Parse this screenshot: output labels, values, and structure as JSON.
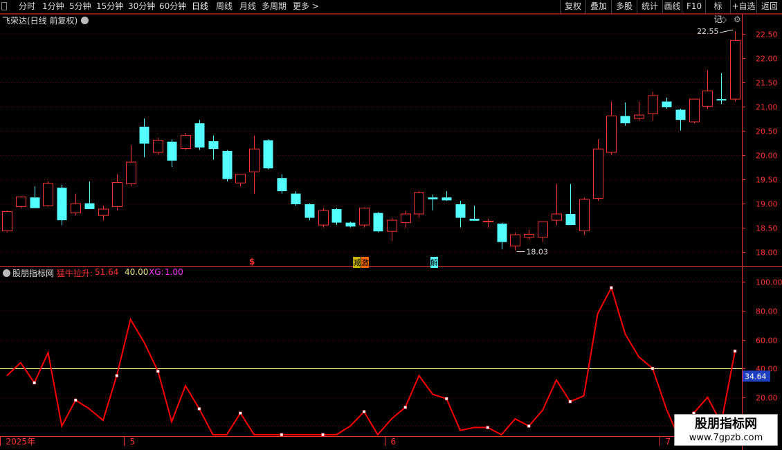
{
  "toolbar": {
    "left_items": [
      "分时",
      "1分钟",
      "5分钟",
      "15分钟",
      "30分钟",
      "60分钟",
      "日线",
      "周线",
      "月线",
      "多周期",
      "更多"
    ],
    "active": "日线",
    "right_items": [
      "复权",
      "叠加",
      "多股",
      "统计",
      "画线",
      "F10",
      "标记",
      "+自选",
      "返回"
    ]
  },
  "main_title": "飞荣达(日线 前复权)",
  "indicator_header": {
    "name": "股朋指标网",
    "s1_label": "猛牛拉升:",
    "s1_value": "51.64",
    "s2_value": "40.00",
    "xg_label": "XG:",
    "xg_value": "1.00"
  },
  "signals": [
    "$",
    "减",
    "激",
    "解"
  ],
  "watermark": {
    "name": "股朋指标网",
    "url": "www.7gpzb.com"
  },
  "colors": {
    "up": "#ff3232",
    "down": "#54ffff",
    "line": "#ff0000",
    "ref": "#f0e68c",
    "grid": "#6b0000",
    "axis": "#ff3232"
  },
  "chart_data": [
    {
      "type": "candlestick",
      "title": "飞荣达(日线 前复权)",
      "y_ticks": [
        18.0,
        18.5,
        19.0,
        19.5,
        20.0,
        20.5,
        21.0,
        21.5,
        22.0,
        22.5
      ],
      "ylim": [
        17.88,
        22.68
      ],
      "annotations": {
        "max": "22.55",
        "min": "18.03"
      },
      "ohlc": [
        [
          18.43,
          18.85,
          18.4,
          18.83
        ],
        [
          18.93,
          19.15,
          18.9,
          19.13
        ],
        [
          19.12,
          19.35,
          18.95,
          18.9
        ],
        [
          18.95,
          19.45,
          18.93,
          19.41
        ],
        [
          19.32,
          19.38,
          18.55,
          18.65
        ],
        [
          18.8,
          19.2,
          18.75,
          18.99
        ],
        [
          19.0,
          19.45,
          18.9,
          18.88
        ],
        [
          18.75,
          18.95,
          18.65,
          18.88
        ],
        [
          18.93,
          19.6,
          18.85,
          19.43
        ],
        [
          19.4,
          20.2,
          19.35,
          19.85
        ],
        [
          20.58,
          20.75,
          19.95,
          20.23
        ],
        [
          20.05,
          20.35,
          20.0,
          20.3
        ],
        [
          20.27,
          20.32,
          19.75,
          19.88
        ],
        [
          20.13,
          20.45,
          20.1,
          20.4
        ],
        [
          20.65,
          20.72,
          20.1,
          20.15
        ],
        [
          20.28,
          20.4,
          19.9,
          20.12
        ],
        [
          20.08,
          20.1,
          19.45,
          19.5
        ],
        [
          19.42,
          19.55,
          19.35,
          19.6
        ],
        [
          19.65,
          20.4,
          19.2,
          20.12
        ],
        [
          20.3,
          20.32,
          19.7,
          19.72
        ],
        [
          19.52,
          19.6,
          19.2,
          19.25
        ],
        [
          19.2,
          19.25,
          18.95,
          18.98
        ],
        [
          18.98,
          19.0,
          18.65,
          18.7
        ],
        [
          18.55,
          18.9,
          18.5,
          18.85
        ],
        [
          18.88,
          18.9,
          18.55,
          18.6
        ],
        [
          18.6,
          18.62,
          18.5,
          18.52
        ],
        [
          18.55,
          18.92,
          18.5,
          18.9
        ],
        [
          18.8,
          18.82,
          18.4,
          18.42
        ],
        [
          18.42,
          18.7,
          18.22,
          18.65
        ],
        [
          18.6,
          18.85,
          18.5,
          18.78
        ],
        [
          18.78,
          19.25,
          18.7,
          19.22
        ],
        [
          19.12,
          19.18,
          18.85,
          19.08
        ],
        [
          19.12,
          19.25,
          19.05,
          19.06
        ],
        [
          18.98,
          19.05,
          18.5,
          18.7
        ],
        [
          18.68,
          18.95,
          18.65,
          18.64
        ],
        [
          18.62,
          18.68,
          18.5,
          18.63
        ],
        [
          18.58,
          18.6,
          18.05,
          18.2
        ],
        [
          18.12,
          18.4,
          18.03,
          18.35
        ],
        [
          18.3,
          18.45,
          18.25,
          18.36
        ],
        [
          18.3,
          18.62,
          18.2,
          18.62
        ],
        [
          18.65,
          19.4,
          18.55,
          18.78
        ],
        [
          18.78,
          19.4,
          18.55,
          18.55
        ],
        [
          18.43,
          19.12,
          18.35,
          19.08
        ],
        [
          19.1,
          20.32,
          19.05,
          20.12
        ],
        [
          20.05,
          21.1,
          20.0,
          20.8
        ],
        [
          20.8,
          21.08,
          20.6,
          20.65
        ],
        [
          20.75,
          21.1,
          20.7,
          20.82
        ],
        [
          20.85,
          21.3,
          20.7,
          21.22
        ],
        [
          21.1,
          21.18,
          20.95,
          20.98
        ],
        [
          20.93,
          20.95,
          20.5,
          20.72
        ],
        [
          20.68,
          21.15,
          20.65,
          21.15
        ],
        [
          21.0,
          21.75,
          20.95,
          21.32
        ],
        [
          21.15,
          21.68,
          21.05,
          21.12
        ],
        [
          21.15,
          22.55,
          21.1,
          22.36
        ]
      ]
    },
    {
      "type": "line",
      "series": [
        {
          "name": "猛牛拉升",
          "values": [
            35,
            44,
            30,
            51,
            0,
            18,
            12,
            4,
            35,
            74,
            58,
            38,
            3,
            28,
            12,
            -6,
            -6,
            9,
            -6,
            -6,
            -6,
            -6,
            -6,
            -6,
            -6,
            0,
            10,
            -6,
            5,
            13,
            35,
            22,
            19,
            -3,
            -1,
            -1,
            -6,
            5,
            0,
            11,
            32,
            17,
            21,
            78,
            96,
            64,
            48,
            40,
            12,
            -10,
            9,
            20,
            2,
            52
          ]
        }
      ],
      "reference_line": 40,
      "current_value_label": "34.64",
      "y_ticks": [
        0.0,
        20.0,
        40.0,
        60.0,
        80.0,
        100.0
      ],
      "ylim": [
        -7,
        104
      ],
      "x_labels": [
        "2025年",
        "5",
        "6",
        "7"
      ],
      "x_label_index": [
        0,
        9,
        28,
        48
      ]
    }
  ]
}
